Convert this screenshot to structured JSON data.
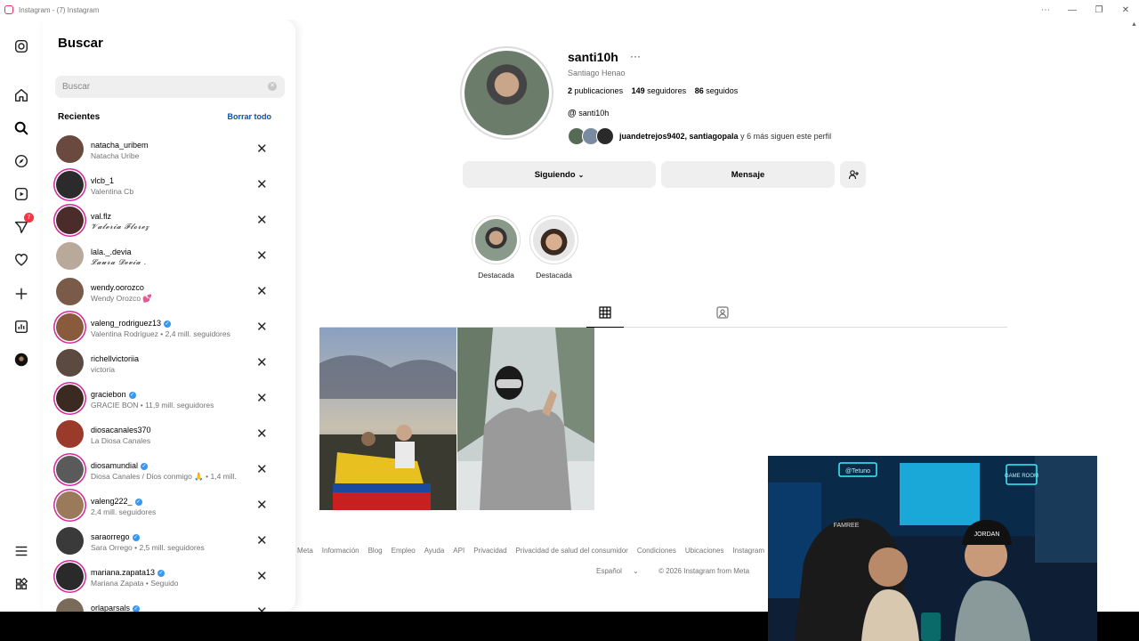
{
  "window": {
    "title": "Instagram - (7) Instagram",
    "buttons": [
      "⋯",
      "—",
      "❐",
      "✕"
    ]
  },
  "rail": {
    "icons": [
      "instagram-logo-icon",
      "home-icon",
      "search-icon",
      "explore-icon",
      "reels-icon",
      "messages-icon",
      "notifications-icon",
      "create-icon",
      "dashboard-icon",
      "profile-icon",
      "menu-icon",
      "more-icon"
    ],
    "messages_badge": "7"
  },
  "search": {
    "title": "Buscar",
    "placeholder": "Buscar",
    "recents_label": "Recientes",
    "clear_all_label": "Borrar todo",
    "items": [
      {
        "username": "natacha_uribem",
        "subtitle": "Natacha Uribe",
        "verified": false,
        "ring": false,
        "avatar_color": "#6a4a3e"
      },
      {
        "username": "vlcb_1",
        "subtitle": "Valentina Cb",
        "verified": false,
        "ring": true,
        "avatar_color": "#2b2b2b"
      },
      {
        "username": "val.flz",
        "subtitle": "𝓥𝓪𝓵𝓮𝓻𝓲𝓪 𝓕𝓵𝓸𝓻𝓮𝔃",
        "verified": false,
        "ring": true,
        "avatar_color": "#4a2c2a"
      },
      {
        "username": "lala._.devia",
        "subtitle": "𝓛𝓪𝓾𝓻𝓪 𝓓𝓮𝓿𝓲𝓪 .",
        "verified": false,
        "ring": false,
        "avatar_color": "#b8a99a"
      },
      {
        "username": "wendy.oorozco",
        "subtitle": "Wendy Orozco 💕",
        "verified": false,
        "ring": false,
        "avatar_color": "#7a5a48"
      },
      {
        "username": "valeng_rodriguez13",
        "subtitle": "Valentina Rodriguez • 2,4 mill. seguidores",
        "verified": true,
        "ring": true,
        "avatar_color": "#8a5a3c"
      },
      {
        "username": "richellvictoriia",
        "subtitle": "victoria",
        "verified": false,
        "ring": false,
        "avatar_color": "#5a4a40"
      },
      {
        "username": "graciebon",
        "subtitle": "GRACIE BON • 11,9 mill. seguidores",
        "verified": true,
        "ring": true,
        "avatar_color": "#3a2a22"
      },
      {
        "username": "diosacanales370",
        "subtitle": "La Diosa Canales",
        "verified": false,
        "ring": false,
        "avatar_color": "#9a3a2a"
      },
      {
        "username": "diosamundial",
        "subtitle": "Diosa Canales / Dios conmigo 🙏 • 1,4 mill.",
        "verified": true,
        "ring": true,
        "avatar_color": "#5a5a5a"
      },
      {
        "username": "valeng222_",
        "subtitle": "2,4 mill. seguidores",
        "verified": true,
        "ring": true,
        "avatar_color": "#9a7a5a"
      },
      {
        "username": "saraorrego",
        "subtitle": "Sara Orrego • 2,5 mill. seguidores",
        "verified": true,
        "ring": false,
        "avatar_color": "#3a3a3a"
      },
      {
        "username": "mariana.zapata13",
        "subtitle": "Mariana Zapata • Seguido",
        "verified": true,
        "ring": true,
        "avatar_color": "#2a2a2a"
      },
      {
        "username": "orlaparsals",
        "subtitle": "",
        "verified": true,
        "ring": false,
        "avatar_color": "#7a6a5a"
      }
    ]
  },
  "profile": {
    "username": "santi10h",
    "more": "···",
    "full_name": "Santiago Henao",
    "posts_count": "2",
    "posts_label": "publicaciones",
    "followers_count": "149",
    "followers_label": "seguidores",
    "following_count": "86",
    "following_label": "seguidos",
    "threads_handle": "santi10h",
    "followed_by_names": "juandetrejos9402, santiagopala",
    "followed_by_rest": " y 6 más siguen este perfil",
    "following_button": "Siguiendo",
    "message_button": "Mensaje",
    "highlights": [
      {
        "label": "Destacada"
      },
      {
        "label": "Destacada"
      }
    ]
  },
  "footer": {
    "links": [
      "Meta",
      "Información",
      "Blog",
      "Empleo",
      "Ayuda",
      "API",
      "Privacidad",
      "Privacidad de salud del consumidor",
      "Condiciones",
      "Ubicaciones",
      "Instagram"
    ],
    "language": "Español",
    "copyright": "© 2026 Instagram from Meta"
  },
  "webcam": {
    "signs": [
      "@Tetuno",
      "GAME ROOM"
    ],
    "cap_text": "JORDAN",
    "cap_left_text": "FAMREE"
  },
  "colors": {
    "accent": "#0a4fa8",
    "verified": "#3897f0",
    "badge": "#ff3040",
    "ring": "#d6249f"
  }
}
